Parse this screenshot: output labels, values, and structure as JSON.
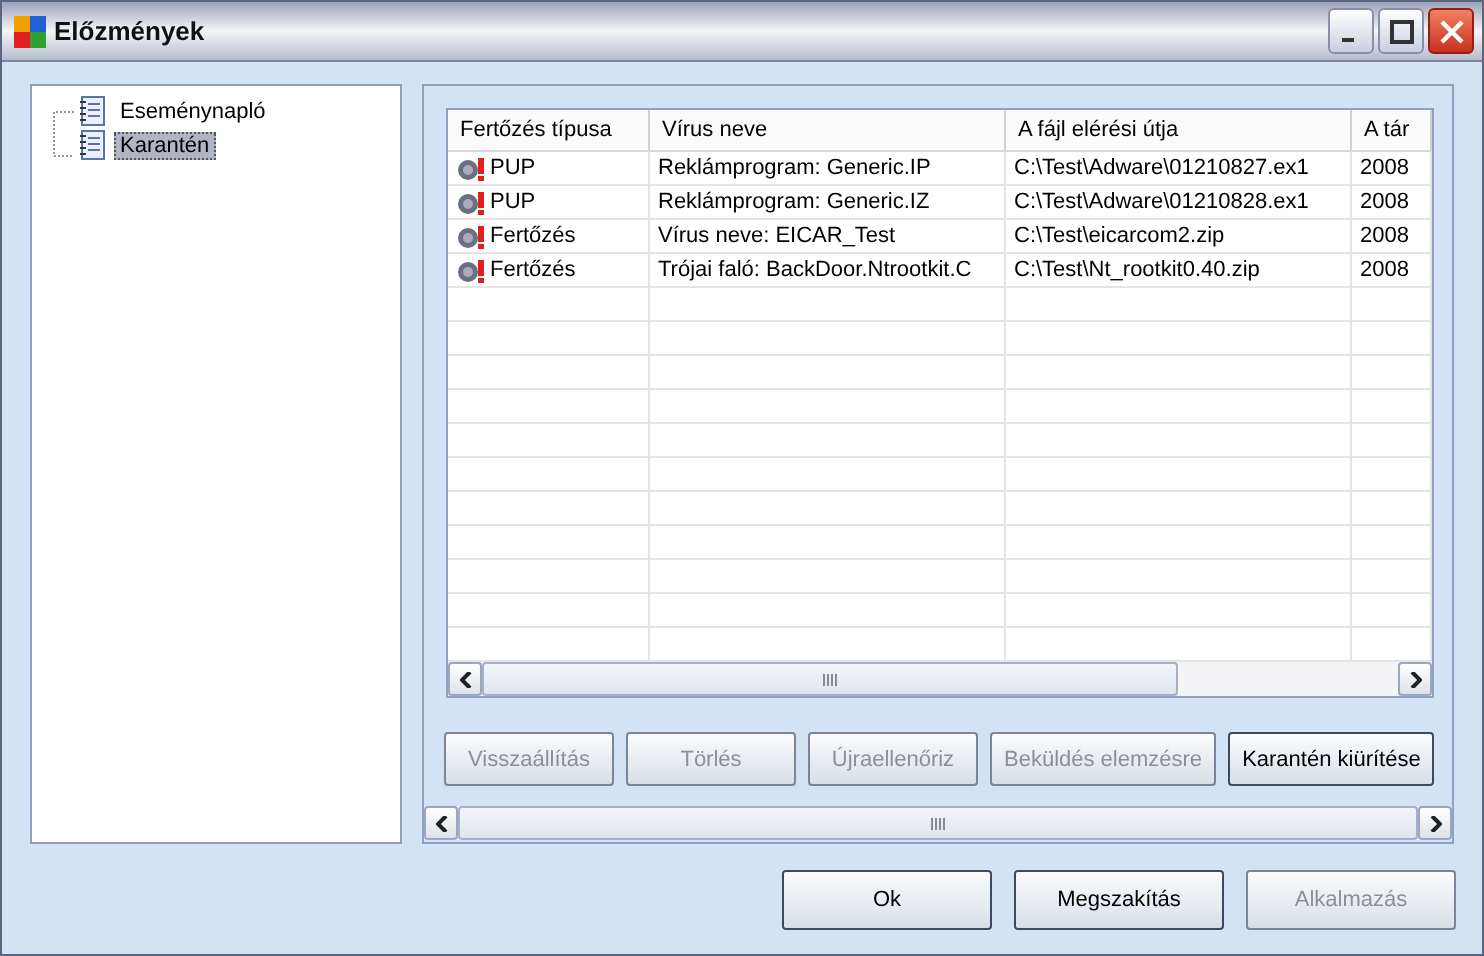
{
  "window": {
    "title": "Előzmények"
  },
  "tree": [
    {
      "label": "Eseménynapló",
      "selected": false
    },
    {
      "label": "Karantén",
      "selected": true
    }
  ],
  "table": {
    "columns": [
      "Fertőzés típusa",
      "Vírus neve",
      "A fájl elérési útja",
      "A tár"
    ],
    "rows": [
      [
        "PUP",
        "Reklámprogram: Generic.IP",
        "C:\\Test\\Adware\\01210827.ex1",
        "2008"
      ],
      [
        "PUP",
        "Reklámprogram: Generic.IZ",
        "C:\\Test\\Adware\\01210828.ex1",
        "2008"
      ],
      [
        "Fertőzés",
        "Vírus neve: EICAR_Test",
        "C:\\Test\\eicarcom2.zip",
        "2008"
      ],
      [
        "Fertőzés",
        "Trójai faló: BackDoor.Ntrootkit.C",
        "C:\\Test\\Nt_rootkit0.40.zip",
        "2008"
      ]
    ]
  },
  "actions": [
    {
      "label": "Visszaállítás",
      "disabled": true
    },
    {
      "label": "Törlés",
      "disabled": true
    },
    {
      "label": "Újraellenőriz",
      "disabled": true
    },
    {
      "label": "Beküldés elemzésre",
      "disabled": true
    },
    {
      "label": "Karantén kiürítése",
      "disabled": false
    }
  ],
  "buttons": [
    {
      "label": "Ok",
      "disabled": false
    },
    {
      "label": "Megszakítás",
      "disabled": false
    },
    {
      "label": "Alkalmazás",
      "disabled": true
    }
  ]
}
